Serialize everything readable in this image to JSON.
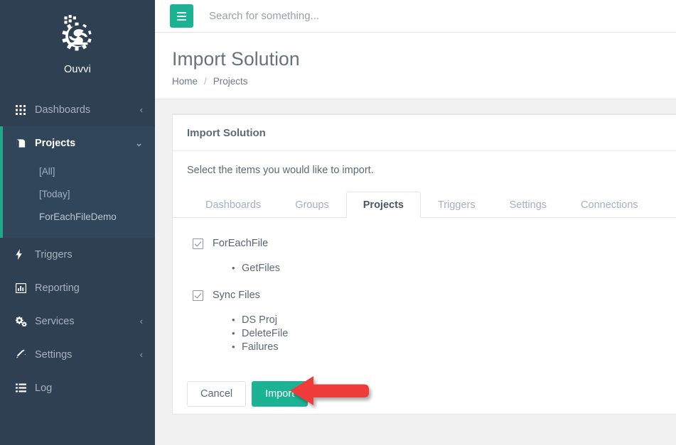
{
  "sidebar": {
    "brand": {
      "name": "Ouvvi",
      "logo_icon": "gear-s-logo-icon"
    },
    "items": [
      {
        "label": "Dashboards",
        "icon": "grid-icon",
        "chevron": "‹",
        "active": false
      },
      {
        "label": "Projects",
        "icon": "book-icon",
        "chevron": "⌄",
        "active": true
      },
      {
        "label": "Triggers",
        "icon": "bolt-icon",
        "chevron": "",
        "active": false
      },
      {
        "label": "Reporting",
        "icon": "bar-chart-icon",
        "chevron": "",
        "active": false
      },
      {
        "label": "Services",
        "icon": "cogs-icon",
        "chevron": "‹",
        "active": false
      },
      {
        "label": "Settings",
        "icon": "wand-icon",
        "chevron": "‹",
        "active": false
      },
      {
        "label": "Log",
        "icon": "list-icon",
        "chevron": "",
        "active": false
      }
    ],
    "projects_subitems": [
      {
        "label": "[All]"
      },
      {
        "label": "[Today]"
      },
      {
        "label": "ForEachFileDemo"
      }
    ],
    "accent_color": "#1fa88b",
    "background_color": "#2e4051"
  },
  "topbar": {
    "menu_icon": "hamburger-icon",
    "menu_color": "#1cb394",
    "search_placeholder": "Search for something...",
    "search_value": ""
  },
  "pagehead": {
    "title": "Import Solution",
    "breadcrumb": {
      "home": "Home",
      "separator": "/",
      "current": "Projects"
    }
  },
  "card": {
    "header": "Import Solution",
    "intro": "Select the items you would like to import.",
    "tabs": [
      {
        "label": "Dashboards",
        "active": false
      },
      {
        "label": "Groups",
        "active": false
      },
      {
        "label": "Projects",
        "active": true
      },
      {
        "label": "Triggers",
        "active": false
      },
      {
        "label": "Settings",
        "active": false
      },
      {
        "label": "Connections",
        "active": false
      }
    ],
    "groups": [
      {
        "label": "ForEachFile",
        "checked": true,
        "children": [
          "GetFiles"
        ]
      },
      {
        "label": "Sync Files",
        "checked": true,
        "children": [
          "DS Proj",
          "DeleteFile",
          "Failures"
        ]
      }
    ],
    "buttons": {
      "cancel": "Cancel",
      "import": "Import"
    }
  },
  "annotation": {
    "arrow": "red-left-arrow",
    "color": "#f03b3b"
  }
}
